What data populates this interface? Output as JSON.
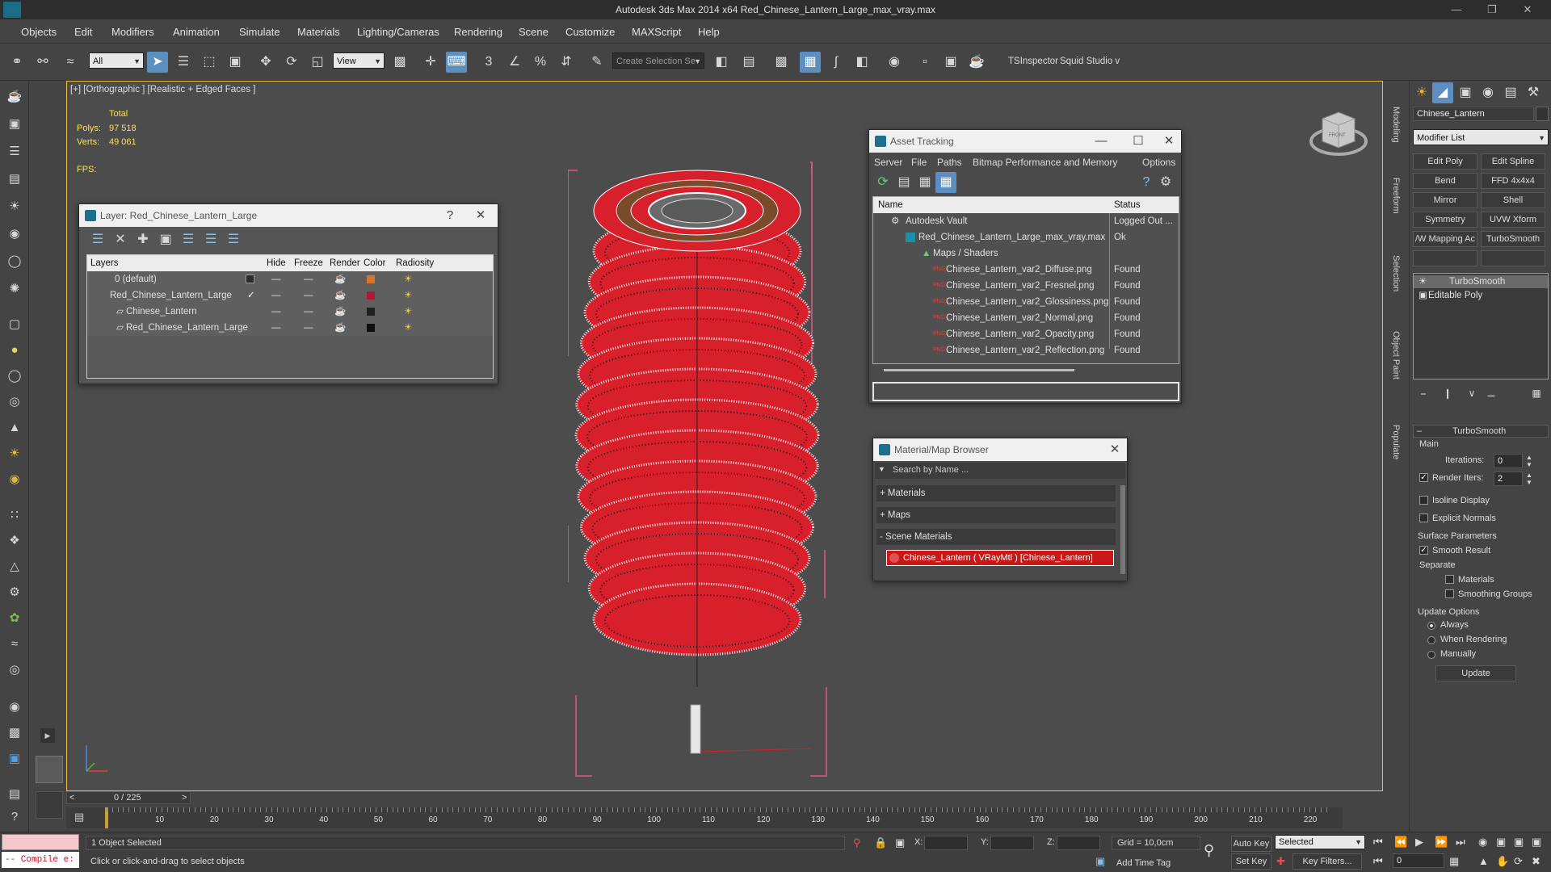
{
  "window": {
    "title": "Autodesk 3ds Max  2014 x64     Red_Chinese_Lantern_Large_max_vray.max"
  },
  "menu": [
    "Objects",
    "Edit",
    "Modifiers",
    "Animation",
    "Simulate",
    "Materials",
    "Lighting/Cameras",
    "Rendering",
    "Scene",
    "Customize",
    "MAXScript",
    "Help"
  ],
  "toolbar": {
    "filter_value": "All",
    "refcoord_value": "View",
    "named_selection_placeholder": "Create Selection Se",
    "ts_inspector": "TSInspector",
    "squid_studio": "Squid Studio v",
    "snap_3": "3",
    "percent": "%"
  },
  "viewport": {
    "label": "[+] [Orthographic ] [Realistic + Edged Faces ]",
    "stats_total": "Total",
    "polys_label": "Polys:",
    "polys_value": "97 518",
    "verts_label": "Verts:",
    "verts_value": "49 061",
    "fps_label": "FPS:",
    "viewcube_label": "FRONT"
  },
  "layer_dialog": {
    "title": "Layer: Red_Chinese_Lantern_Large",
    "help": "?",
    "columns": [
      "Layers",
      "Hide",
      "Freeze",
      "Render",
      "Color",
      "Radiosity"
    ],
    "rows": [
      {
        "name": "0 (default)",
        "color": "#d4762c"
      },
      {
        "name": "Red_Chinese_Lantern_Large",
        "color": "#b0183a"
      },
      {
        "name": "Chinese_Lantern",
        "color": "#202020"
      },
      {
        "name": "Red_Chinese_Lantern_Large",
        "color": "#101010"
      }
    ]
  },
  "asset_tracking": {
    "title": "Asset Tracking",
    "menu": [
      "Server",
      "File",
      "Paths",
      "Bitmap Performance and Memory",
      "Options"
    ],
    "columns": [
      "Name",
      "Status"
    ],
    "rows": [
      {
        "name": "Autodesk Vault",
        "status": "Logged Out ..."
      },
      {
        "name": "Red_Chinese_Lantern_Large_max_vray.max",
        "status": "Ok"
      },
      {
        "name": "Maps / Shaders",
        "status": ""
      },
      {
        "name": "Chinese_Lantern_var2_Diffuse.png",
        "status": "Found"
      },
      {
        "name": "Chinese_Lantern_var2_Fresnel.png",
        "status": "Found"
      },
      {
        "name": "Chinese_Lantern_var2_Glossiness.png",
        "status": "Found"
      },
      {
        "name": "Chinese_Lantern_var2_Normal.png",
        "status": "Found"
      },
      {
        "name": "Chinese_Lantern_var2_Opacity.png",
        "status": "Found"
      },
      {
        "name": "Chinese_Lantern_var2_Reflection.png",
        "status": "Found"
      }
    ],
    "png_tag": "PNG"
  },
  "material_browser": {
    "title": "Material/Map Browser",
    "search_placeholder": "Search by Name ...",
    "groups": [
      "+ Materials",
      "+ Maps",
      "- Scene Materials"
    ],
    "scene_material": "Chinese_Lantern  ( VRayMtl )  [Chinese_Lantern]"
  },
  "command_panel": {
    "object_name": "Chinese_Lantern",
    "modifier_list": "Modifier List",
    "modifier_buttons": [
      "Edit Poly",
      "Edit Spline",
      "Bend",
      "FFD 4x4x4",
      "Mirror",
      "Shell",
      "Symmetry",
      "UVW Xform",
      "/W Mapping Ac",
      "TurboSmooth"
    ],
    "stack": [
      "TurboSmooth",
      "Editable Poly"
    ],
    "rollout_title": "TurboSmooth",
    "main_label": "Main",
    "iterations_label": "Iterations:",
    "iterations_value": "0",
    "render_iters_label": "Render Iters:",
    "render_iters_value": "2",
    "isoline_label": "Isoline Display",
    "explicit_normals_label": "Explicit Normals",
    "surface_params_label": "Surface Parameters",
    "smooth_result_label": "Smooth Result",
    "separate_label": "Separate",
    "materials_label": "Materials",
    "smoothing_groups_label": "Smoothing Groups",
    "update_options_label": "Update Options",
    "always_label": "Always",
    "when_rendering_label": "When Rendering",
    "manually_label": "Manually",
    "update_button": "Update"
  },
  "side_tabs": [
    "Modeling",
    "Freeform",
    "Selection",
    "Object Paint",
    "Populate"
  ],
  "timeline": {
    "frame_counter": "0 / 225",
    "ticks": [
      "10",
      "20",
      "30",
      "40",
      "50",
      "60",
      "70",
      "80",
      "90",
      "100",
      "110",
      "120",
      "130",
      "140",
      "150",
      "160",
      "170",
      "180",
      "190",
      "200",
      "210",
      "220"
    ]
  },
  "status": {
    "compile_label": "-- Compile e:",
    "selection_status": "1 Object Selected",
    "prompt": "Click or click-and-drag to select objects",
    "x_label": "X:",
    "y_label": "Y:",
    "z_label": "Z:",
    "grid": "Grid = 10,0cm",
    "auto_key": "Auto Key",
    "set_key": "Set Key",
    "selected_value": "Selected",
    "key_filters": "Key Filters...",
    "add_time_tag": "Add Time Tag",
    "frame_value": "0"
  },
  "colors": {
    "lantern_red": "#d8202c",
    "wire": "#ffffff",
    "bbox": "#e05a84",
    "highlight": "#5c8ec0"
  }
}
